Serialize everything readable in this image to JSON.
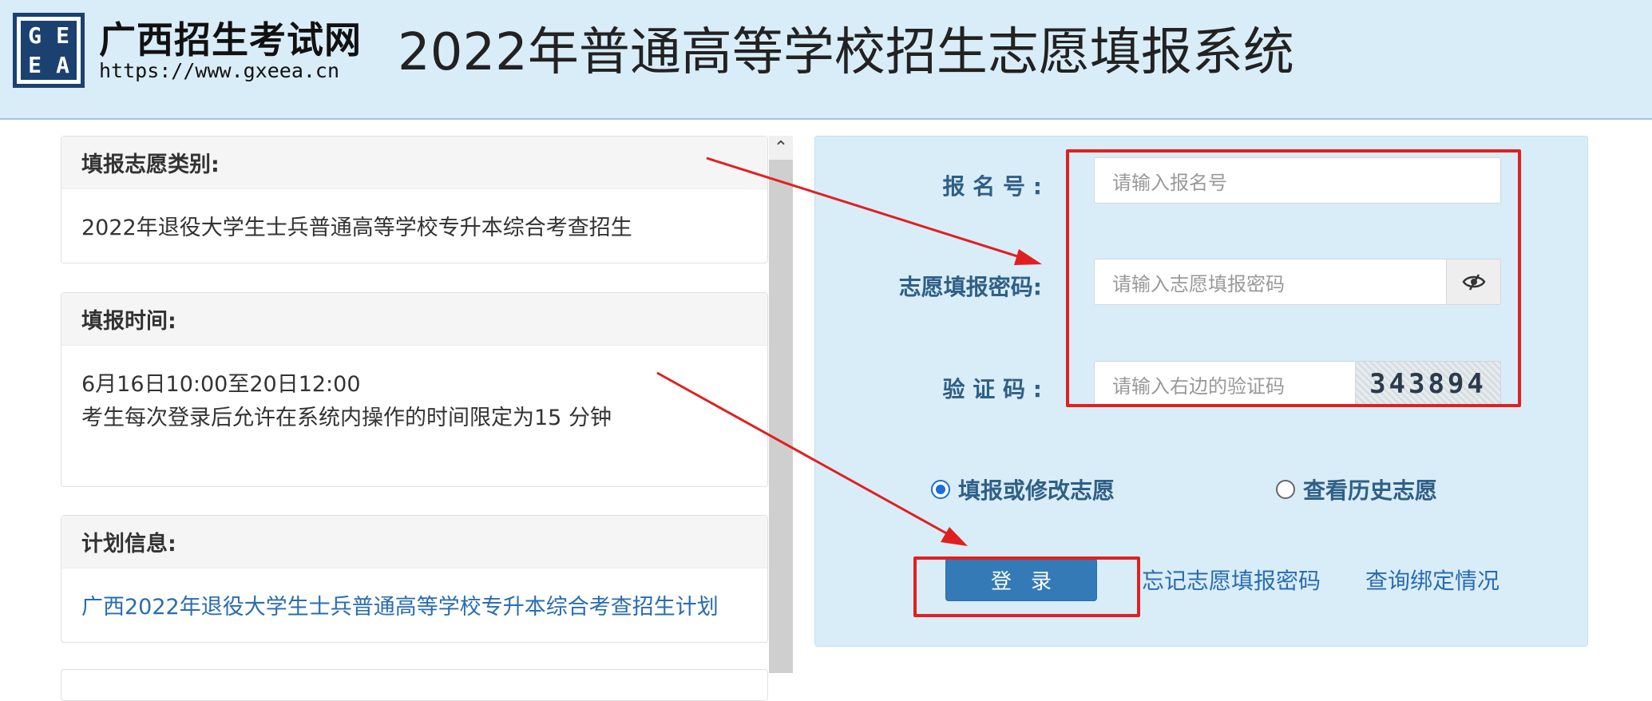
{
  "header": {
    "logo_letters": [
      "G",
      "E",
      "E",
      "A"
    ],
    "site_name": "广西招生考试网",
    "site_url": "https://www.gxeea.cn",
    "system_title": "2022年普通高等学校招生志愿填报系统"
  },
  "info_panels": [
    {
      "title": "填报志愿类别:",
      "lines": [
        "2022年退役大学生士兵普通高等学校专升本综合考查招生"
      ]
    },
    {
      "title": "填报时间:",
      "lines": [
        "6月16日10:00至20日12:00",
        "考生每次登录后允许在系统内操作的时间限定为15 分钟"
      ]
    },
    {
      "title": "计划信息:",
      "link": "广西2022年退役大学生士兵普通高等学校专升本综合考查招生计划"
    }
  ],
  "login_form": {
    "reg_label": "报 名 号 :",
    "reg_placeholder": "请输入报名号",
    "password_label": "志愿填报密码:",
    "password_placeholder": "请输入志愿填报密码",
    "captcha_label": "验 证 码 :",
    "captcha_placeholder": "请输入右边的验证码",
    "captcha_value": "343894",
    "radio_options": [
      {
        "label": "填报或修改志愿",
        "checked": true
      },
      {
        "label": "查看历史志愿",
        "checked": false
      }
    ],
    "login_button": "登录",
    "forgot_link": "忘记志愿填报密码",
    "query_link": "查询绑定情况"
  },
  "colors": {
    "header_bg": "#d9edf8",
    "panel_bg": "#d9edf8",
    "label_color": "#2f5f86",
    "button_bg": "#347ab7",
    "annotation_red": "#e02020",
    "link_color": "#2a6cb0"
  }
}
